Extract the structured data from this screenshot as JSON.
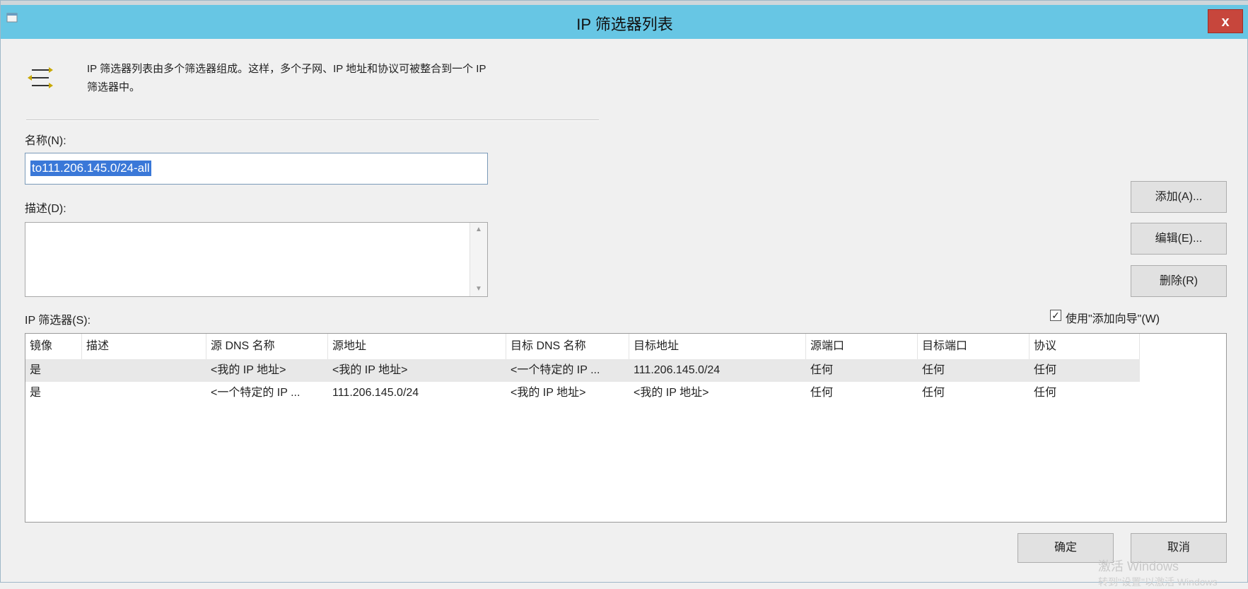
{
  "window": {
    "title": "IP 筛选器列表",
    "close_label": "x"
  },
  "header": {
    "icon": "filter-list-icon",
    "intro_line1": "IP 筛选器列表由多个筛选器组成。这样，多个子网、IP 地址和协议可被整合到一个 IP",
    "intro_line2": "筛选器中。"
  },
  "name_field": {
    "label": "名称(N):",
    "value": "to111.206.145.0/24-all"
  },
  "description_field": {
    "label": "描述(D):",
    "value": ""
  },
  "buttons": {
    "add": "添加(A)...",
    "edit": "编辑(E)...",
    "remove": "删除(R)",
    "ok": "确定",
    "cancel": "取消"
  },
  "wizard_checkbox": {
    "label": "使用\"添加向导\"(W)",
    "checked": true
  },
  "filters": {
    "label": "IP 筛选器(S):",
    "columns": [
      "镜像",
      "描述",
      "源 DNS 名称",
      "源地址",
      "目标 DNS 名称",
      "目标地址",
      "源端口",
      "目标端口",
      "协议"
    ],
    "rows": [
      [
        "是",
        "",
        "<我的 IP 地址>",
        "<我的 IP 地址>",
        "<一个特定的 IP ...",
        "111.206.145.0/24",
        "任何",
        "任何",
        "任何"
      ],
      [
        "是",
        "",
        "<一个特定的 IP ...",
        "111.206.145.0/24",
        "<我的 IP 地址>",
        "<我的 IP 地址>",
        "任何",
        "任何",
        "任何"
      ]
    ]
  },
  "watermark": {
    "line1": "激活 Windows",
    "line2": "转到\"设置\"以激活 Windows"
  }
}
